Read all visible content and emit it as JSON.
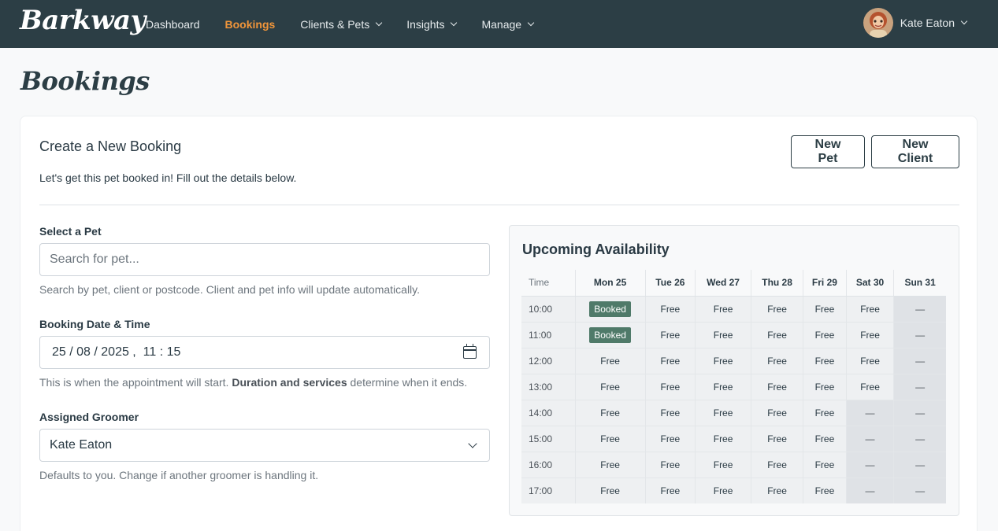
{
  "navbar": {
    "brand": "Barkway",
    "items": [
      {
        "label": "Dashboard",
        "active": false,
        "dropdown": false
      },
      {
        "label": "Bookings",
        "active": true,
        "dropdown": false
      },
      {
        "label": "Clients & Pets",
        "active": false,
        "dropdown": true
      },
      {
        "label": "Insights",
        "active": false,
        "dropdown": true
      },
      {
        "label": "Manage",
        "active": false,
        "dropdown": true
      }
    ],
    "user_name": "Kate Eaton"
  },
  "page": {
    "title": "Bookings"
  },
  "card": {
    "title": "Create a New Booking",
    "subtitle": "Let's get this pet booked in! Fill out the details below.",
    "new_pet_label": "New Pet",
    "new_client_label": "New Client"
  },
  "form": {
    "pet_label": "Select a Pet",
    "pet_placeholder": "Search for pet...",
    "pet_help": "Search by pet, client or postcode. Client and pet info will update automatically.",
    "datetime_label": "Booking Date & Time",
    "datetime_value": "25 / 08 / 2025 ,  11 : 15",
    "datetime_help_pre": "This is when the appointment will start. ",
    "datetime_help_bold": "Duration and services",
    "datetime_help_post": " determine when it ends.",
    "groomer_label": "Assigned Groomer",
    "groomer_value": "Kate Eaton",
    "groomer_help": "Defaults to you. Change if another groomer is handling it."
  },
  "availability": {
    "title": "Upcoming Availability",
    "time_header": "Time",
    "days": [
      "Mon 25",
      "Tue 26",
      "Wed 27",
      "Thu 28",
      "Fri 29",
      "Sat 30",
      "Sun 31"
    ],
    "rows": [
      {
        "time": "10:00",
        "slots": [
          "Booked",
          "Free",
          "Free",
          "Free",
          "Free",
          "Free",
          "—"
        ]
      },
      {
        "time": "11:00",
        "slots": [
          "Booked",
          "Free",
          "Free",
          "Free",
          "Free",
          "Free",
          "—"
        ]
      },
      {
        "time": "12:00",
        "slots": [
          "Free",
          "Free",
          "Free",
          "Free",
          "Free",
          "Free",
          "—"
        ]
      },
      {
        "time": "13:00",
        "slots": [
          "Free",
          "Free",
          "Free",
          "Free",
          "Free",
          "Free",
          "—"
        ]
      },
      {
        "time": "14:00",
        "slots": [
          "Free",
          "Free",
          "Free",
          "Free",
          "Free",
          "—",
          "—"
        ]
      },
      {
        "time": "15:00",
        "slots": [
          "Free",
          "Free",
          "Free",
          "Free",
          "Free",
          "—",
          "—"
        ]
      },
      {
        "time": "16:00",
        "slots": [
          "Free",
          "Free",
          "Free",
          "Free",
          "Free",
          "—",
          "—"
        ]
      },
      {
        "time": "17:00",
        "slots": [
          "Free",
          "Free",
          "Free",
          "Free",
          "Free",
          "—",
          "—"
        ]
      }
    ]
  },
  "colors": {
    "navbar_bg": "#2c3e45",
    "active_nav": "#f0953a",
    "booked_badge": "#4f7a69",
    "unavailable_cell": "#dfe2e6"
  }
}
